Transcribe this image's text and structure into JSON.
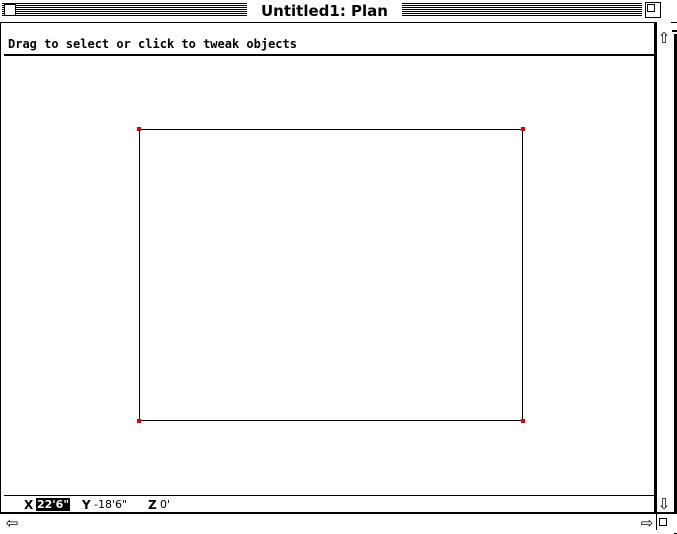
{
  "window": {
    "title": "Untitled1: Plan",
    "close_icon": "close-box-icon",
    "zoom_icon": "zoom-box-icon"
  },
  "status": {
    "message": "Drag to select or click to tweak objects"
  },
  "canvas": {
    "shape": "rectangle",
    "handle_color": "#e00000"
  },
  "coords": {
    "x_label": "X",
    "x_value": "22'6\"",
    "y_label": "Y",
    "y_value": "-18'6\"",
    "z_label": "Z",
    "z_value": "0'"
  },
  "scrollbars": {
    "up_icon": "⇧",
    "down_icon": "⇩",
    "left_icon": "⇦",
    "right_icon": "⇨"
  }
}
